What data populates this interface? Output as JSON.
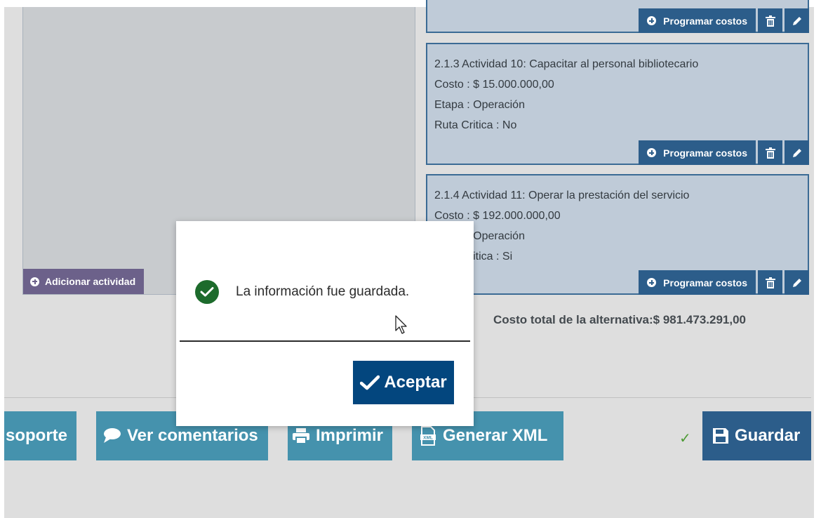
{
  "left_panel": {
    "add_activity_label": "Adicionar actividad"
  },
  "cards": [
    {
      "lines": [],
      "program_label": "Programar costos"
    },
    {
      "lines": [
        "2.1.3 Actividad 10: Capacitar al personal bibliotecario",
        "Costo : $ 15.000.000,00",
        "Etapa : Operación",
        "Ruta Critica : No"
      ],
      "program_label": "Programar costos"
    },
    {
      "lines": [
        "2.1.4 Actividad 11: Operar la prestación del servicio",
        "Costo : $ 192.000.000,00",
        "Etapa : Operación",
        "Ruta Critica : Si"
      ],
      "program_label": "Programar costos"
    }
  ],
  "total_label": "Costo total de la alternativa:$ 981.473.291,00",
  "toolbar": {
    "soporte": "soporte",
    "comentarios": "Ver comentarios",
    "imprimir": "Imprimir",
    "xml": "Generar XML",
    "guardar": "Guardar",
    "saved_check": "✓"
  },
  "modal": {
    "message": "La información fue guardada.",
    "accept_label": "Aceptar"
  },
  "icons": [
    "plus-circle-icon",
    "trash-icon",
    "pencil-icon",
    "comment-icon",
    "printer-icon",
    "xml-file-icon",
    "floppy-disk-icon",
    "check-icon",
    "cursor-icon"
  ],
  "colors": {
    "primary": "#2c5d8a",
    "toolbar": "#4592ad",
    "accept": "#03467e",
    "success": "#1d6b2c",
    "add_activity": "#6c618a"
  }
}
